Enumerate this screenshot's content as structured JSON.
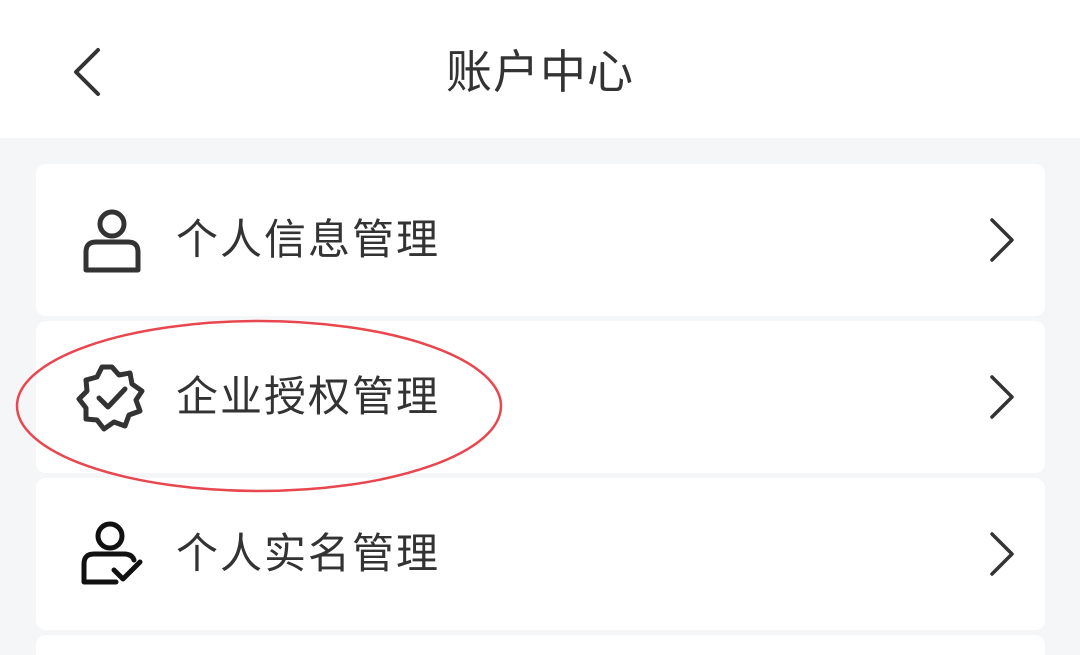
{
  "header": {
    "title": "账户中心",
    "back_icon": "chevron-left-icon"
  },
  "menu": {
    "items": [
      {
        "label": "个人信息管理",
        "icon": "user-icon"
      },
      {
        "label": "企业授权管理",
        "icon": "badge-check-icon"
      },
      {
        "label": "个人实名管理",
        "icon": "user-verified-icon"
      }
    ]
  },
  "colors": {
    "background": "#f5f6f8",
    "card": "#ffffff",
    "text": "#333333",
    "annotation": "#e8474f"
  }
}
